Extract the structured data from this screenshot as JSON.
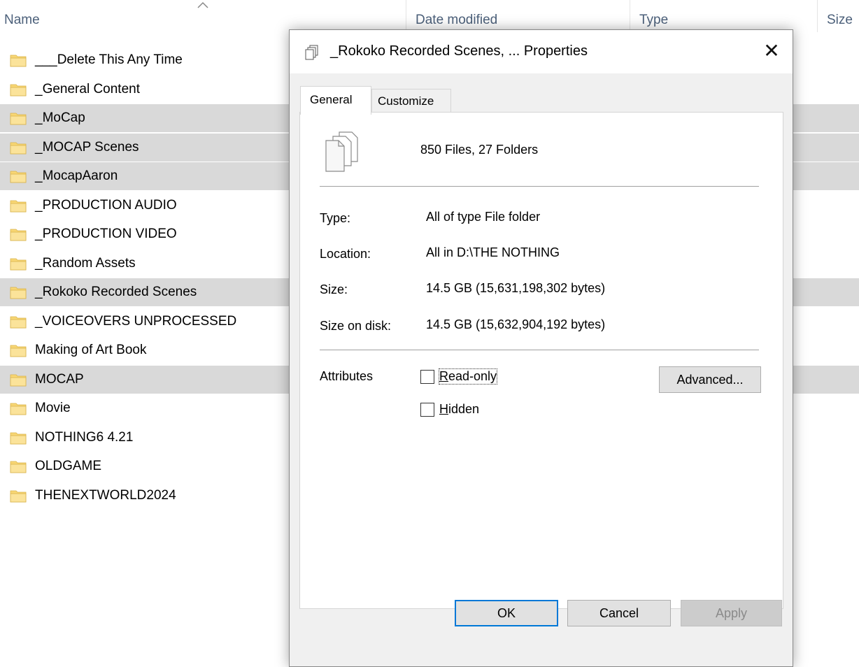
{
  "explorer": {
    "columns": {
      "name": "Name",
      "date_modified": "Date modified",
      "type": "Type",
      "size": "Size"
    },
    "folders": [
      {
        "name": "___Delete This Any Time",
        "selected": false
      },
      {
        "name": "_General Content",
        "selected": false
      },
      {
        "name": "_MoCap",
        "selected": true
      },
      {
        "name": "_MOCAP Scenes",
        "selected": true
      },
      {
        "name": "_MocapAaron",
        "selected": true
      },
      {
        "name": "_PRODUCTION AUDIO",
        "selected": false
      },
      {
        "name": "_PRODUCTION VIDEO",
        "selected": false
      },
      {
        "name": "_Random Assets",
        "selected": false
      },
      {
        "name": "_Rokoko Recorded Scenes",
        "selected": true
      },
      {
        "name": "_VOICEOVERS UNPROCESSED",
        "selected": false
      },
      {
        "name": "Making of Art Book",
        "selected": false
      },
      {
        "name": "MOCAP",
        "selected": true
      },
      {
        "name": "Movie",
        "selected": false
      },
      {
        "name": "NOTHING6 4.21",
        "selected": false
      },
      {
        "name": "OLDGAME",
        "selected": false
      },
      {
        "name": "THENEXTWORLD2024",
        "selected": false
      }
    ],
    "folder_icon": "folder-icon",
    "sort_icon": "sort-ascending-icon"
  },
  "dialog": {
    "title": "_Rokoko Recorded Scenes, ... Properties",
    "title_icon": "multiple-files-icon",
    "close_label": "✕",
    "tabs": {
      "general": "General",
      "customize": "Customize"
    },
    "summary": "850 Files, 27 Folders",
    "summary_icon": "multiple-files-icon",
    "properties": {
      "type_label": "Type:",
      "type_value": "All of type File folder",
      "location_label": "Location:",
      "location_value": "All in D:\\THE NOTHING",
      "size_label": "Size:",
      "size_value": "14.5 GB (15,631,198,302 bytes)",
      "size_on_disk_label": "Size on disk:",
      "size_on_disk_value": "14.5 GB (15,632,904,192 bytes)"
    },
    "attributes": {
      "label": "Attributes",
      "read_only_label": "Read-only",
      "read_only_checked": false,
      "hidden_label": "Hidden",
      "hidden_checked": false,
      "advanced_button": "Advanced..."
    },
    "buttons": {
      "ok": "OK",
      "cancel": "Cancel",
      "apply": "Apply"
    }
  },
  "colors": {
    "selection": "#d9d9d9",
    "header_text": "#4c607a",
    "folder_yellow": "#f8d775",
    "default_button_border": "#0078d7"
  }
}
